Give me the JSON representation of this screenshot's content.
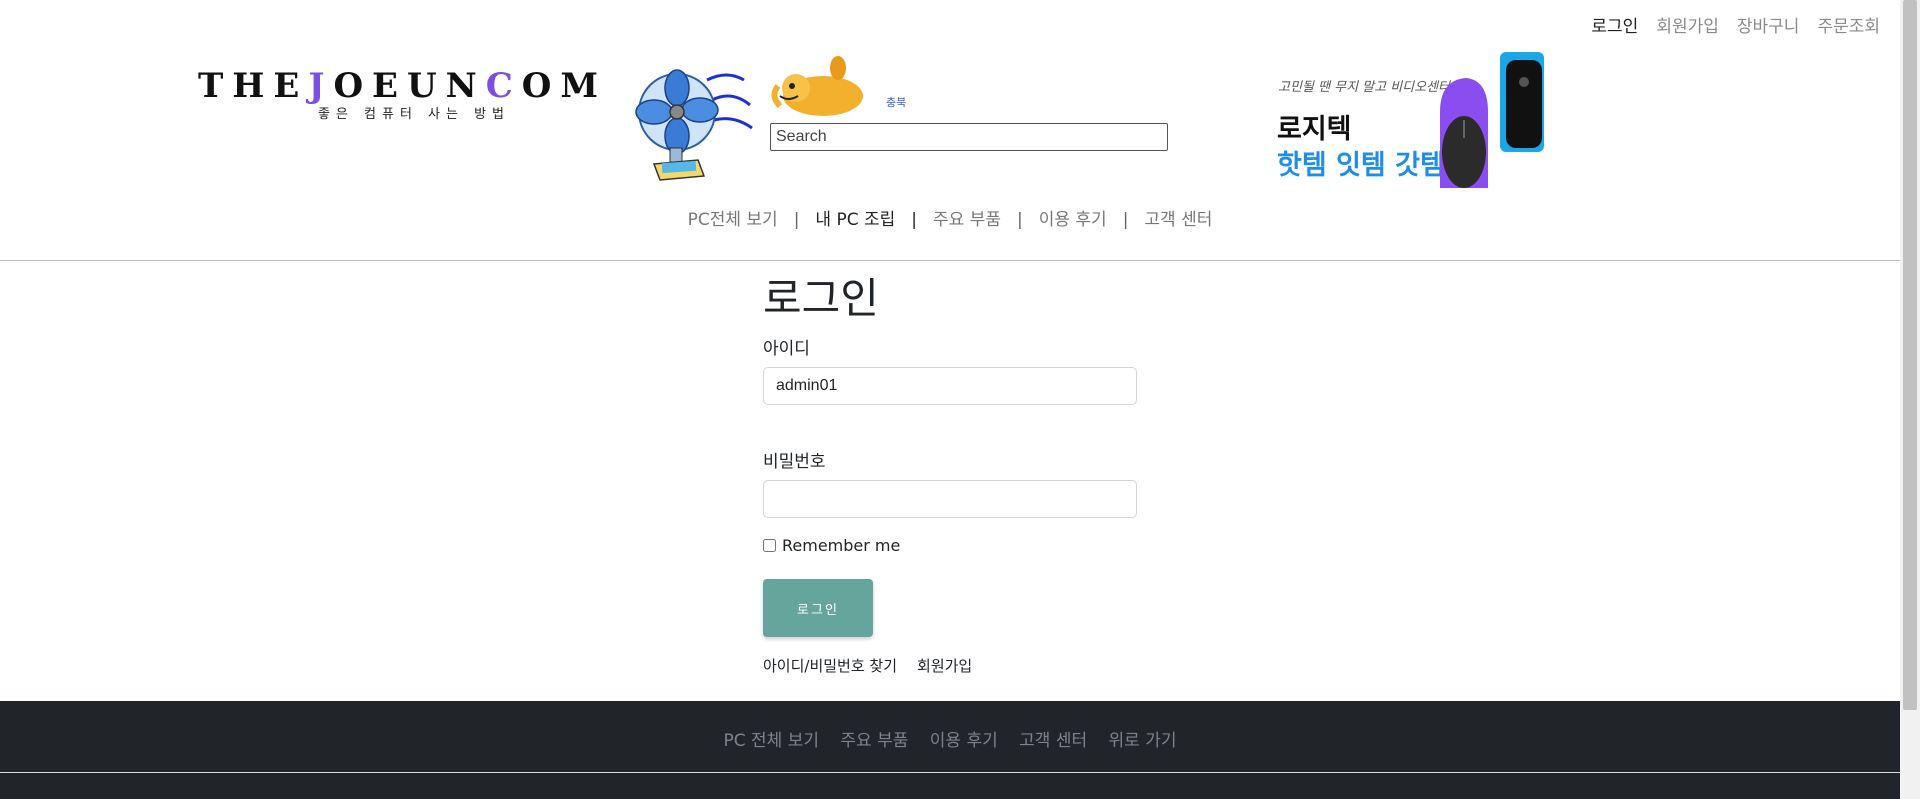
{
  "topbar": {
    "items": [
      "로그인",
      "회원가입",
      "장바구니",
      "주문조회"
    ]
  },
  "logo": {
    "text_parts": [
      "THE",
      "J",
      "OEUN",
      "C",
      "OM"
    ],
    "subtitle": "좋은 컴퓨터 사는 방법",
    "accent_color": "#7d4fe0"
  },
  "mascot": {
    "tag": "충북"
  },
  "search": {
    "placeholder": "Search",
    "value": ""
  },
  "banner": {
    "small": "고민될 땐 무지 말고 비디오센터",
    "line1": "로지텍",
    "line2": "핫템 잇템 갓템"
  },
  "nav": {
    "items": [
      "PC전체 보기",
      "내 PC 조립",
      "주요 부품",
      "이용 후기",
      "고객 센터"
    ],
    "separator": "|",
    "active_index": 1
  },
  "login": {
    "title": "로그인",
    "id_label": "아이디",
    "id_value": "admin01",
    "pw_label": "비밀번호",
    "pw_value": "",
    "remember_label": "Remember me",
    "remember_checked": false,
    "submit_label": "로그인",
    "submit_color": "#66a59b",
    "find_link": "아이디/비밀번호 찾기",
    "signup_link": "회원가입"
  },
  "footer": {
    "items": [
      "PC 전체 보기",
      "주요 부품",
      "이용 후기",
      "고객 센터",
      "위로 가기"
    ],
    "bg_color": "#212529"
  }
}
